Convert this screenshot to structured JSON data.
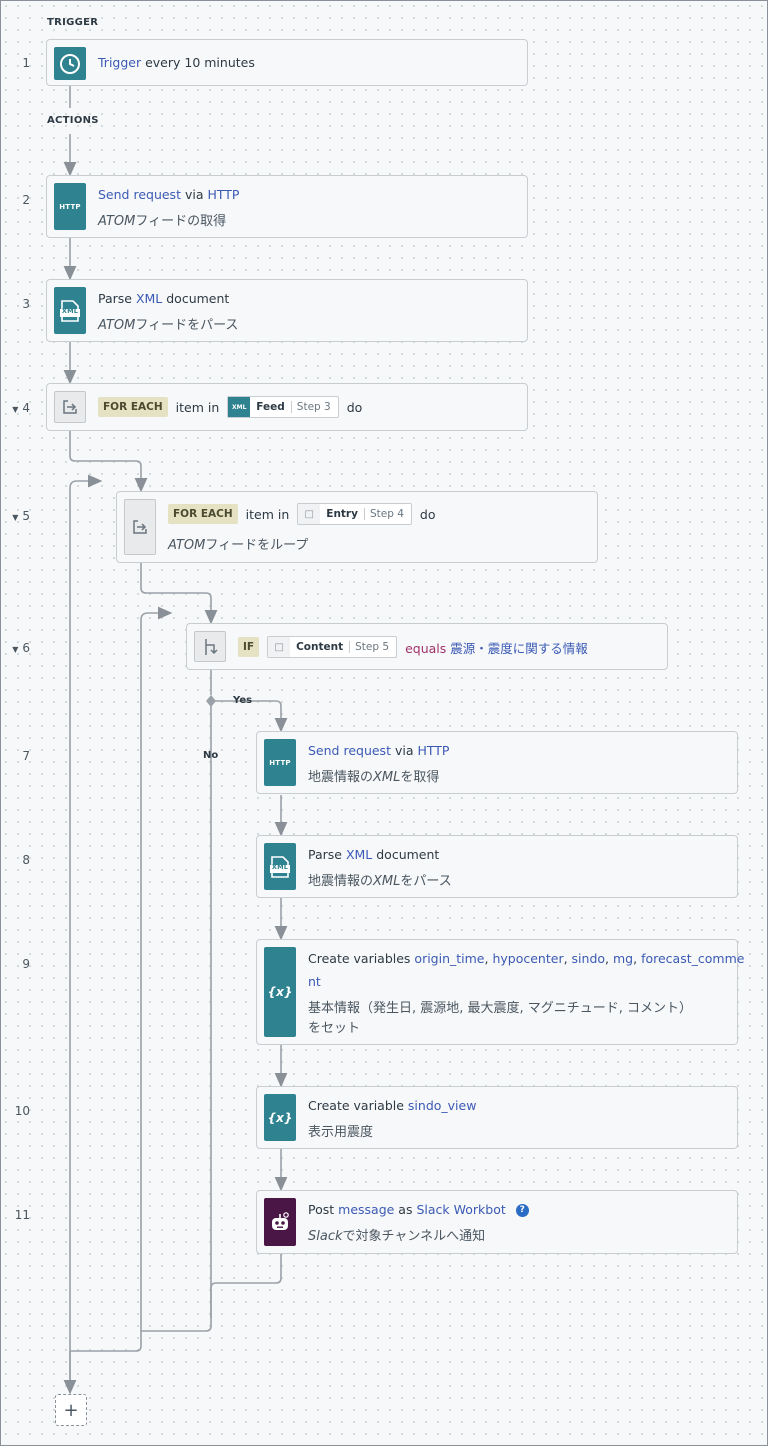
{
  "sections": {
    "trigger": "TRIGGER",
    "actions": "ACTIONS"
  },
  "branches": {
    "yes": "Yes",
    "no": "No"
  },
  "add_button": "+",
  "steps": [
    {
      "num": "1",
      "icon": "clock-icon",
      "parts": {
        "a": "Trigger",
        "b": " every 10 minutes"
      }
    },
    {
      "num": "2",
      "icon": "http-icon",
      "icon_text": "HTTP",
      "parts": {
        "a": "Send request",
        "b": " via ",
        "c": "HTTP"
      },
      "desc": {
        "italic": "ATOM",
        "rest": "フィードの取得"
      }
    },
    {
      "num": "3",
      "icon": "xml-document-icon",
      "icon_text": "XML",
      "parts": {
        "a": "Parse ",
        "b": "XML",
        "c": " document"
      },
      "desc": {
        "italic": "ATOM",
        "rest": "フィードをパース"
      }
    },
    {
      "num": "4",
      "icon": "loop-icon",
      "tag": "FOR EACH",
      "pre": "item in",
      "pill": {
        "icon_text": "XML",
        "name": "Feed",
        "step": "Step 3"
      },
      "post": "do"
    },
    {
      "num": "5",
      "icon": "loop-icon",
      "tag": "FOR EACH",
      "pre": "item in",
      "pill": {
        "name": "Entry",
        "step": "Step 4"
      },
      "post": "do",
      "desc": {
        "italic": "ATOM",
        "rest": "フィードをループ"
      }
    },
    {
      "num": "6",
      "icon": "branch-icon",
      "tag": "IF",
      "pill": {
        "name": "Content",
        "step": "Step 5"
      },
      "op": "equals",
      "value": "震源・震度に関する情報"
    },
    {
      "num": "7",
      "icon": "http-icon",
      "icon_text": "HTTP",
      "parts": {
        "a": "Send request",
        "b": " via ",
        "c": "HTTP"
      },
      "desc": {
        "pre": "地震情報の",
        "italic": "XML",
        "rest": "を取得"
      }
    },
    {
      "num": "8",
      "icon": "xml-document-icon",
      "icon_text": "XML",
      "parts": {
        "a": "Parse ",
        "b": "XML",
        "c": " document"
      },
      "desc": {
        "pre": "地震情報の",
        "italic": "XML",
        "rest": "をパース"
      }
    },
    {
      "num": "9",
      "icon": "variable-icon",
      "icon_text": "{x}",
      "parts": {
        "a": "Create variables ",
        "v1": "origin_time",
        "v2": "hypocenter",
        "v3": "sindo",
        "v4": "mg",
        "v5a": "forecast_comme",
        "v5b": "nt",
        "sep": ", "
      },
      "desc": {
        "line1": "基本情報（発生日, 震源地, 最大震度, マグニチュード, コメント）",
        "line2": "をセット"
      }
    },
    {
      "num": "10",
      "icon": "variable-icon",
      "icon_text": "{x}",
      "parts": {
        "a": "Create variable ",
        "b": "sindo_view"
      },
      "desc": {
        "rest": "表示用震度"
      }
    },
    {
      "num": "11",
      "icon": "slack-bot-icon",
      "parts": {
        "a": "Post ",
        "b": "message",
        "c": " as ",
        "d": "Slack Workbot"
      },
      "desc": {
        "italic": "Slack",
        "rest": "で対象チャンネルへ通知"
      }
    }
  ]
}
